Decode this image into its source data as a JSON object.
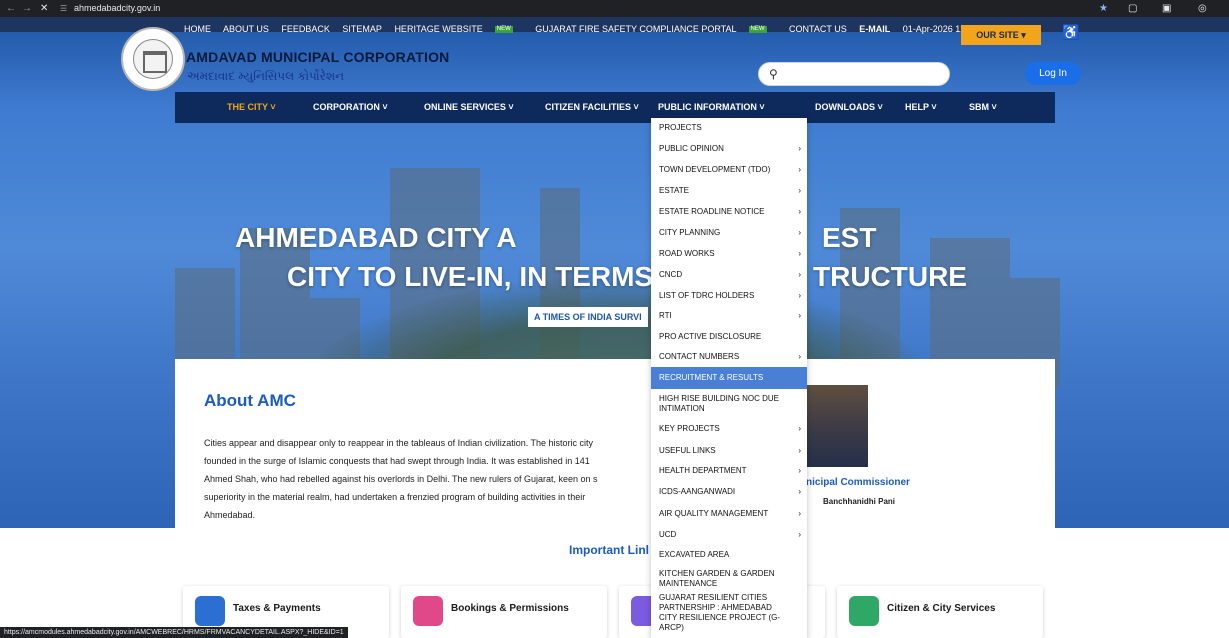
{
  "browser": {
    "url": "ahmedabadcity.gov.in",
    "status_url": "https://amcmodules.ahmedabadcity.gov.in/AMCWEBREC/HRMS/FRMVACANCYDETAIL.ASPX?_HIDE&ID=1"
  },
  "topnav": {
    "items": [
      "HOME",
      "ABOUT US",
      "FEEDBACK",
      "SITEMAP",
      "HERITAGE WEBSITE",
      "GUJARAT FIRE SAFETY COMPLIANCE PORTAL",
      "CONTACT US",
      "E-MAIL"
    ],
    "datetime": "01-Apr-2026 12:12:32 PM",
    "our_site": "OUR SITE",
    "new_badge": "NEW"
  },
  "header": {
    "org_name": "AMDAVAD MUNICIPAL CORPORATION",
    "org_name_gujarati": "અમદાવાદ મ્યુનિસિપલ કોર્પોરેશન",
    "login": "Log In"
  },
  "mainnav": {
    "items": [
      "THE CITY",
      "CORPORATION",
      "ONLINE SERVICES",
      "CITIZEN FACILITIES",
      "PUBLIC INFORMATION",
      "DOWNLOADS",
      "HELP",
      "SBM"
    ]
  },
  "hero": {
    "line1": "AHMEDABAD CITY A",
    "line1b": "EST",
    "line2": "CITY TO LIVE-IN, IN TERMS",
    "line2b": "TRUCTURE",
    "badge": "A TIMES OF INDIA SURVI"
  },
  "dropdown": {
    "items": [
      {
        "label": "PROJECTS",
        "arrow": false
      },
      {
        "label": "PUBLIC OPINION",
        "arrow": true
      },
      {
        "label": "TOWN DEVELOPMENT (TDO)",
        "arrow": true
      },
      {
        "label": "ESTATE",
        "arrow": true
      },
      {
        "label": "ESTATE ROADLINE NOTICE",
        "arrow": true
      },
      {
        "label": "CITY PLANNING",
        "arrow": true
      },
      {
        "label": "ROAD WORKS",
        "arrow": true
      },
      {
        "label": "CNCD",
        "arrow": true
      },
      {
        "label": "LIST OF TDRC HOLDERS",
        "arrow": true
      },
      {
        "label": "RTI",
        "arrow": true
      },
      {
        "label": "PRO ACTIVE DISCLOSURE",
        "arrow": false
      },
      {
        "label": "CONTACT NUMBERS",
        "arrow": true
      },
      {
        "label": "RECRUITMENT & RESULTS",
        "arrow": false
      },
      {
        "label": "HIGH RISE BUILDING NOC DUE INTIMATION",
        "arrow": false
      },
      {
        "label": "KEY PROJECTS",
        "arrow": true
      },
      {
        "label": "USEFUL LINKS",
        "arrow": true
      },
      {
        "label": "HEALTH DEPARTMENT",
        "arrow": true
      },
      {
        "label": "ICDS-AANGANWADI",
        "arrow": true
      },
      {
        "label": "AIR QUALITY MANAGEMENT",
        "arrow": true
      },
      {
        "label": "UCD",
        "arrow": true
      },
      {
        "label": "EXCAVATED AREA",
        "arrow": false
      },
      {
        "label": "KITCHEN GARDEN & GARDEN MAINTENANCE",
        "arrow": false
      },
      {
        "label": "GUJARAT RESILIENT CITIES PARTNERSHIP : AHMEDABAD CITY RESILIENCE PROJECT (G-ARCP)",
        "arrow": false
      }
    ],
    "highlighted": "RECRUITMENT & RESULTS"
  },
  "about": {
    "title": "About AMC",
    "line1": "Cities appear and disappear only to reappear in the tableaus of Indian civilization. The historic city",
    "line2": "founded in the surge of Islamic conquests that had swept through India. It was established in 141",
    "line3": "Ahmed Shah, who had rebelled against his overlords in Delhi. The new rulers of Gujarat, keen on s",
    "line4": "superiority in the material realm, had undertaken a frenzied program of building activities in their",
    "line5": "Ahmedabad.",
    "commissioner_title": "nicipal Commissioner",
    "commissioner_name": "Banchhanidhi Pani"
  },
  "important_links": "Important Linl",
  "cards": [
    {
      "label": "Taxes & Payments",
      "color": "#2a6fd1"
    },
    {
      "label": "Bookings & Permissions",
      "color": "#e0488a"
    },
    {
      "label": "",
      "color": "#7b5be0"
    },
    {
      "label": "Citizen & City Services",
      "color": "#2fa866"
    }
  ]
}
